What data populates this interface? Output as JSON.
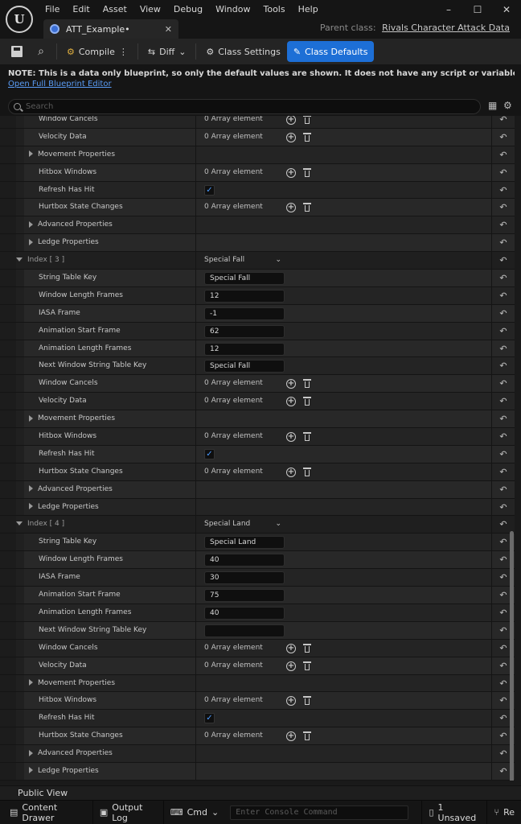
{
  "app": {
    "logo": "U"
  },
  "menu": [
    "File",
    "Edit",
    "Asset",
    "View",
    "Debug",
    "Window",
    "Tools",
    "Help"
  ],
  "window_controls": {
    "minimize": "–",
    "maximize": "☐",
    "close": "✕"
  },
  "tab": {
    "title": "ATT_Example•",
    "close": "✕",
    "icon": "blueprint-icon"
  },
  "parent_class": {
    "label": "Parent class:",
    "value": "Rivals Character Attack Data"
  },
  "toolbar": {
    "compile": "Compile",
    "diff": "Diff",
    "class_settings": "Class Settings",
    "class_defaults": "Class Defaults"
  },
  "notice": {
    "text": "NOTE: This is a data only blueprint, so only the default values are shown.  It does not have any script or variables.  If you want to add sor",
    "link": "Open Full Blueprint Editor"
  },
  "search": {
    "placeholder": "Search"
  },
  "rows": [
    {
      "type": "array",
      "name": "Window Cancels",
      "value": "0 Array element"
    },
    {
      "type": "array",
      "name": "Velocity Data",
      "value": "0 Array element"
    },
    {
      "type": "group",
      "name": "Movement Properties"
    },
    {
      "type": "array",
      "name": "Hitbox Windows",
      "value": "0 Array element"
    },
    {
      "type": "check",
      "name": "Refresh Has Hit",
      "value": "✓"
    },
    {
      "type": "array",
      "name": "Hurtbox State Changes",
      "value": "0 Array element"
    },
    {
      "type": "group",
      "name": "Advanced Properties"
    },
    {
      "type": "group",
      "name": "Ledge Properties"
    },
    {
      "type": "section",
      "name": "Index [ 3 ]",
      "value": "Special Fall"
    },
    {
      "type": "text",
      "name": "String Table Key",
      "value": "Special Fall"
    },
    {
      "type": "text",
      "name": "Window Length Frames",
      "value": "12"
    },
    {
      "type": "text",
      "name": "IASA Frame",
      "value": "-1"
    },
    {
      "type": "text",
      "name": "Animation Start Frame",
      "value": "62"
    },
    {
      "type": "text",
      "name": "Animation Length Frames",
      "value": "12"
    },
    {
      "type": "text",
      "name": "Next Window String Table Key",
      "value": "Special Fall"
    },
    {
      "type": "array",
      "name": "Window Cancels",
      "value": "0 Array element"
    },
    {
      "type": "array",
      "name": "Velocity Data",
      "value": "0 Array element"
    },
    {
      "type": "group",
      "name": "Movement Properties"
    },
    {
      "type": "array",
      "name": "Hitbox Windows",
      "value": "0 Array element"
    },
    {
      "type": "check",
      "name": "Refresh Has Hit",
      "value": "✓"
    },
    {
      "type": "array",
      "name": "Hurtbox State Changes",
      "value": "0 Array element"
    },
    {
      "type": "group",
      "name": "Advanced Properties"
    },
    {
      "type": "group",
      "name": "Ledge Properties"
    },
    {
      "type": "section",
      "name": "Index [ 4 ]",
      "value": "Special Land"
    },
    {
      "type": "text",
      "name": "String Table Key",
      "value": "Special Land"
    },
    {
      "type": "text",
      "name": "Window Length Frames",
      "value": "40"
    },
    {
      "type": "text",
      "name": "IASA Frame",
      "value": "30"
    },
    {
      "type": "text",
      "name": "Animation Start Frame",
      "value": "75"
    },
    {
      "type": "text",
      "name": "Animation Length Frames",
      "value": "40"
    },
    {
      "type": "text",
      "name": "Next Window String Table Key",
      "value": ""
    },
    {
      "type": "array",
      "name": "Window Cancels",
      "value": "0 Array element"
    },
    {
      "type": "array",
      "name": "Velocity Data",
      "value": "0 Array element"
    },
    {
      "type": "group",
      "name": "Movement Properties"
    },
    {
      "type": "array",
      "name": "Hitbox Windows",
      "value": "0 Array element"
    },
    {
      "type": "check",
      "name": "Refresh Has Hit",
      "value": "✓"
    },
    {
      "type": "array",
      "name": "Hurtbox State Changes",
      "value": "0 Array element"
    },
    {
      "type": "group",
      "name": "Advanced Properties"
    },
    {
      "type": "group",
      "name": "Ledge Properties"
    }
  ],
  "public_view": "Public View",
  "statusbar": {
    "content_drawer": "Content Drawer",
    "output_log": "Output Log",
    "cmd": "Cmd",
    "console_placeholder": "Enter Console Command",
    "unsaved": "1 Unsaved",
    "revision": "Re"
  },
  "colors": {
    "accent": "#1d6fd6",
    "link": "#5a9cf5",
    "check": "#4a9aff"
  }
}
